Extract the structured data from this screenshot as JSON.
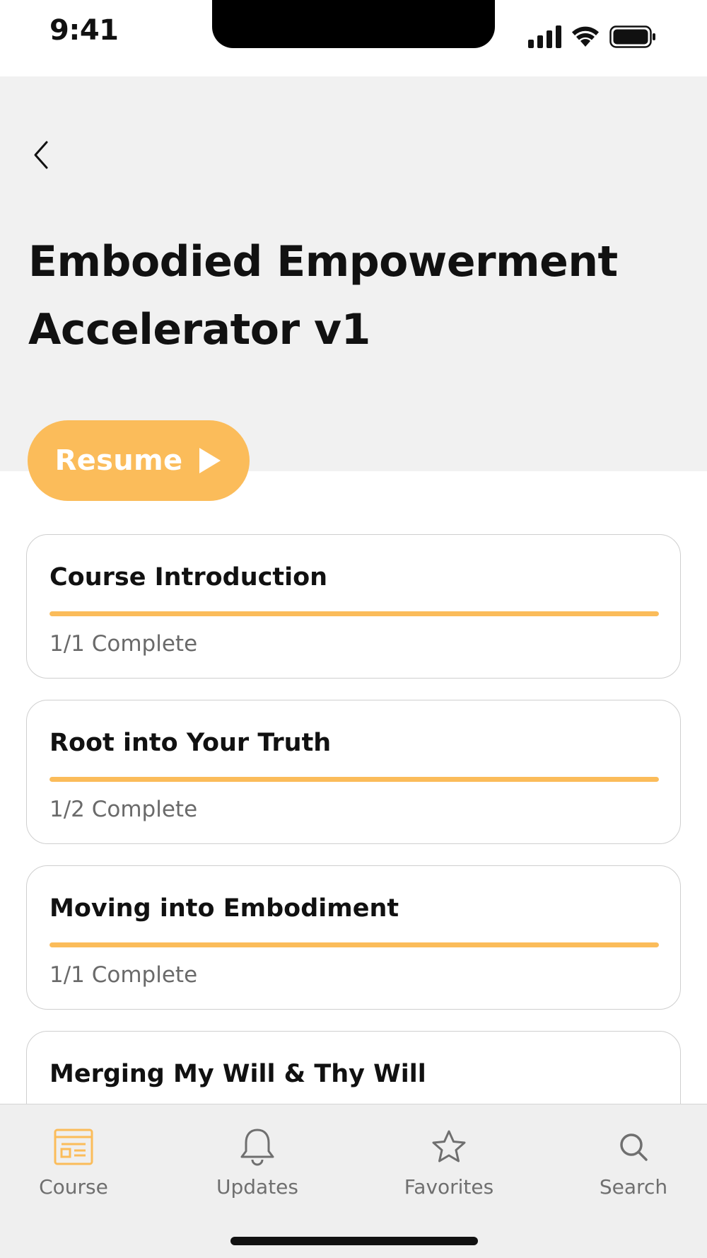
{
  "status_bar": {
    "time": "9:41"
  },
  "header": {
    "back_icon": "chevron-left-icon",
    "title": "Embodied Empowerment Accelerator v1",
    "background": "#f1f1f1"
  },
  "resume": {
    "label": "Resume",
    "icon": "play-icon",
    "color": "#fbbc5a"
  },
  "modules": [
    {
      "title": "Course Introduction",
      "status": "1/1 Complete",
      "progress": 1.0
    },
    {
      "title": "Root into Your Truth",
      "status": "1/2 Complete",
      "progress": 1.0
    },
    {
      "title": "Moving into Embodiment",
      "status": "1/1 Complete",
      "progress": 1.0
    },
    {
      "title": "Merging My Will & Thy Will",
      "status": "",
      "progress": 0
    }
  ],
  "tab_bar": {
    "active": "course",
    "active_color": "#fbbc5a",
    "tabs": [
      {
        "label": "Course",
        "icon": "course-icon"
      },
      {
        "label": "Updates",
        "icon": "bell-icon"
      },
      {
        "label": "Favorites",
        "icon": "star-icon"
      },
      {
        "label": "Search",
        "icon": "search-icon"
      }
    ]
  }
}
